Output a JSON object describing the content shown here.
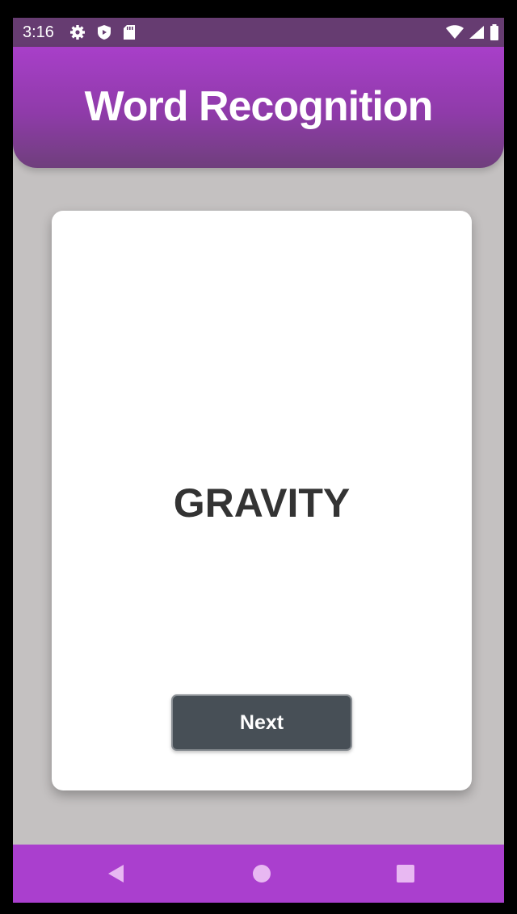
{
  "status_bar": {
    "time": "3:16",
    "icons": [
      "gear-icon",
      "shield-icon",
      "sd-card-icon",
      "wifi-icon",
      "signal-icon",
      "battery-icon"
    ]
  },
  "header": {
    "title": "Word Recognition"
  },
  "card": {
    "word": "GRAVITY",
    "next_label": "Next"
  },
  "nav_bar": {
    "buttons": [
      "back-icon",
      "home-icon",
      "recents-icon"
    ]
  },
  "colors": {
    "header_top": "#a83fc9",
    "header_bottom": "#6f3f7c",
    "status_bar": "#663c71",
    "background": "#c4c1c1",
    "button": "#474f56",
    "nav_bar": "#aa3fce"
  }
}
